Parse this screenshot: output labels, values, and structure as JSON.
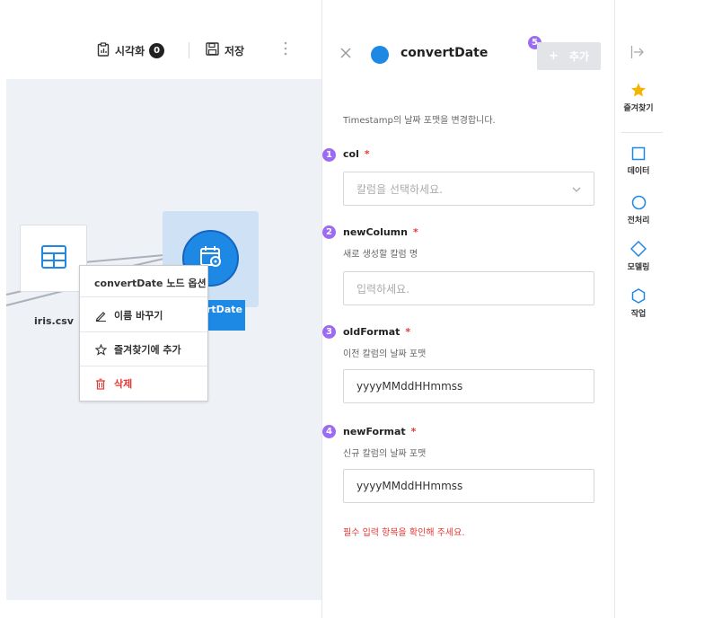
{
  "toolbar": {
    "visualize_label": "시각화",
    "visualize_count": "0",
    "save_label": "저장",
    "more_label": "⋮"
  },
  "canvas": {
    "iris_node_label": "iris.csv",
    "convert_node_label": "rtDate"
  },
  "context_menu": {
    "title": "convertDate 노드 옵션",
    "rename_label": "이름 바꾸기",
    "favorite_label": "즐겨찾기에 추가",
    "delete_label": "삭제"
  },
  "panel": {
    "title": "convertDate",
    "add_button_label": "추가",
    "add_button_plus": "+",
    "description": "Timestamp의 날짜 포맷을 변경합니다.",
    "fields": [
      {
        "number": "1",
        "label": "col",
        "required": "*",
        "subtitle": "",
        "placeholder": "칼럼을 선택하세요.",
        "value": ""
      },
      {
        "number": "2",
        "label": "newColumn",
        "required": "*",
        "subtitle": "새로 생성할 칼럼 명",
        "placeholder": "입력하세요.",
        "value": ""
      },
      {
        "number": "3",
        "label": "oldFormat",
        "required": "*",
        "subtitle": "이전 칼럼의 날짜 포맷",
        "placeholder": "",
        "value": "yyyyMMddHHmmss"
      },
      {
        "number": "4",
        "label": "newFormat",
        "required": "*",
        "subtitle": "신규 칼럼의 날짜 포맷",
        "placeholder": "",
        "value": "yyyyMMddHHmmss"
      }
    ],
    "add_button_number": "5",
    "error_message": "필수 입력 항목을 확인해 주세요."
  },
  "sidebar": {
    "items": [
      {
        "label": "즐겨찾기",
        "icon": "star-icon"
      },
      {
        "label": "데이터",
        "icon": "square-icon"
      },
      {
        "label": "전처리",
        "icon": "circle-icon"
      },
      {
        "label": "모델링",
        "icon": "diamond-icon"
      },
      {
        "label": "작업",
        "icon": "hexagon-icon"
      }
    ]
  },
  "colors": {
    "accent": "#1e88e5",
    "step_badge": "#9b6cf2",
    "error": "#e53935",
    "favorite": "#f5b400"
  }
}
